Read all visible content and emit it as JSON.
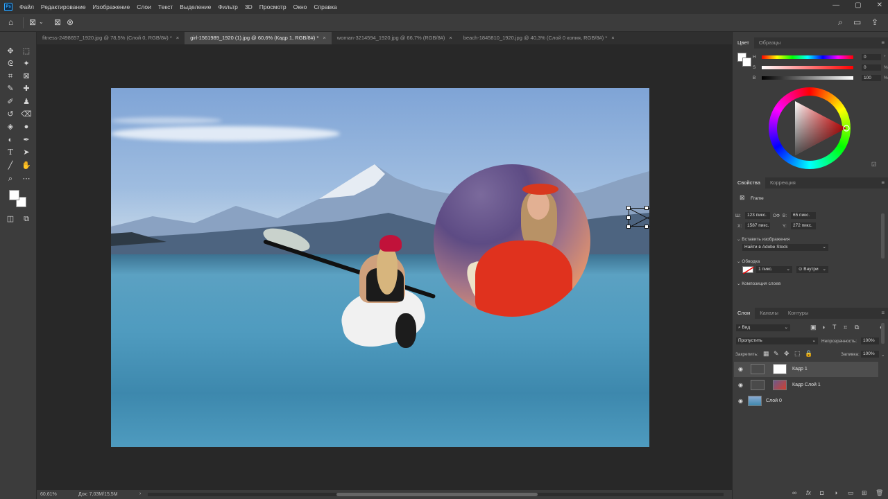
{
  "app": {
    "logo": "Ps"
  },
  "menu": [
    "Файл",
    "Редактирование",
    "Изображение",
    "Слои",
    "Текст",
    "Выделение",
    "Фильтр",
    "3D",
    "Просмотр",
    "Окно",
    "Справка"
  ],
  "window_controls": {
    "minimize": "—",
    "maximize": "▢",
    "close": "✕"
  },
  "tabs": [
    {
      "label": "fitness-2498657_1920.jpg @ 78,5% (Слой 0, RGB/8#) *",
      "close": "×"
    },
    {
      "label": "girl-1561989_1920 (1).jpg @ 60,6% (Кадр 1, RGB/8#) *",
      "close": "×"
    },
    {
      "label": "woman-3214594_1920.jpg @ 66,7% (RGB/8#)",
      "close": "×"
    },
    {
      "label": "beach-1845810_1920.jpg @ 40,3% (Слой 0 копия, RGB/8#) *",
      "close": "×"
    }
  ],
  "status": {
    "zoom": "60,61%",
    "doc": "Док: 7,03M/15,5M",
    "arrow": "›"
  },
  "color_panel": {
    "tabs": [
      "Цвет",
      "Образцы"
    ],
    "sliders": [
      {
        "label": "H",
        "value": "0",
        "unit": "°"
      },
      {
        "label": "S",
        "value": "0",
        "unit": "%"
      },
      {
        "label": "B",
        "value": "100",
        "unit": "%"
      }
    ]
  },
  "properties_panel": {
    "tabs": [
      "Свойства",
      "Коррекция"
    ],
    "type_label": "Frame",
    "w_label": "Ш:",
    "w_value": "123 пикс.",
    "link_label": "ОФ",
    "h_label": "В:",
    "h_value": "65 пикс.",
    "x_label": "X:",
    "x_value": "1587 пикс.",
    "y_label": "Y:",
    "y_value": "272 пикс.",
    "insert_image": "Вставить изображения",
    "insert_option": "Найти в Adobe Stock",
    "stroke": "Обводка",
    "stroke_width": "1 пикс.",
    "stroke_position": "Внутри",
    "layer_comps": "Композиция слоев"
  },
  "layers_panel": {
    "tabs": [
      "Слои",
      "Каналы",
      "Контуры"
    ],
    "filter_label": "Вид",
    "blend_mode": "Пропустить",
    "opacity_label": "Непрозрачность:",
    "opacity_value": "100%",
    "lock_label": "Закрепить:",
    "fill_label": "Заливка:",
    "fill_value": "100%",
    "layers": [
      {
        "name": "Кадр 1",
        "selected": true
      },
      {
        "name": "Кадр Слой 1",
        "selected": false
      },
      {
        "name": "Слой 0",
        "selected": false
      }
    ]
  },
  "icons": {
    "home": "home-icon",
    "frame": "frame-tool-icon",
    "search": "search-icon",
    "eye": "eye-icon",
    "link": "link-icon",
    "trash": "trash-icon"
  },
  "colors": {
    "accent": "#31a8ff",
    "panel": "#3c3c3c",
    "workspace": "#282828"
  }
}
